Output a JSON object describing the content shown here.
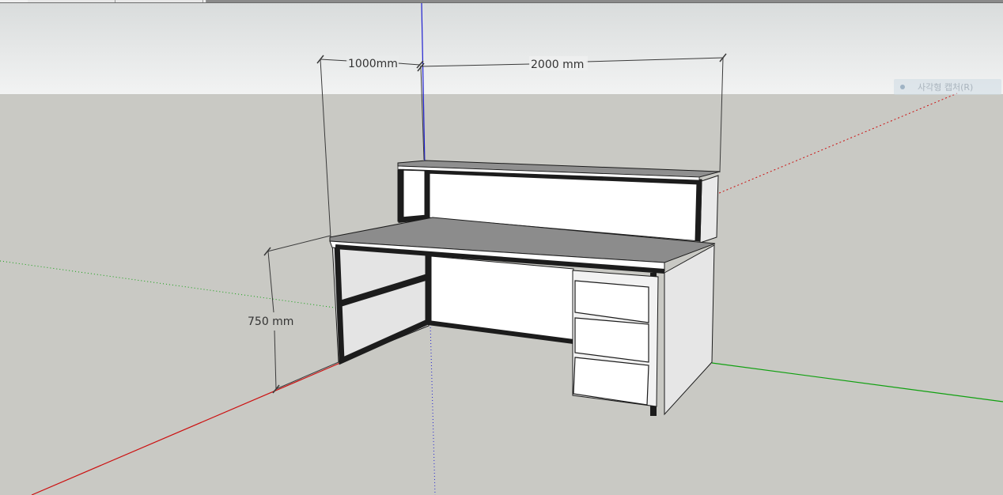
{
  "viewport": {
    "dimensions": {
      "width_label": "1000mm",
      "length_label": "2000 mm",
      "height_label": "750 mm"
    },
    "scene_tab": {
      "label": "사각형 캡처(R)"
    }
  },
  "colors": {
    "sky_top": "#d9dcdc",
    "ground": "#c9c9c4",
    "red_axis": "#cc1010",
    "green_axis": "#10a010",
    "blue_axis": "#2020d0",
    "frame": "#1c1c1c",
    "desk_top": "#8c8c8c",
    "panel": "#ffffff"
  }
}
